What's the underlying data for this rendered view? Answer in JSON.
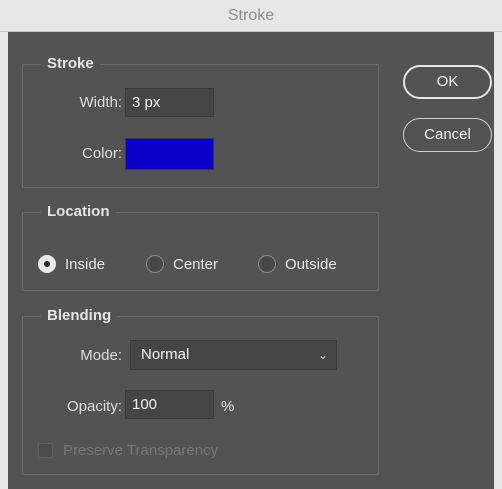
{
  "window": {
    "title": "Stroke"
  },
  "buttons": {
    "ok": "OK",
    "cancel": "Cancel"
  },
  "stroke": {
    "title": "Stroke",
    "width_label": "Width:",
    "width_value": "3 px",
    "color_label": "Color:",
    "color_value": "#0a00c8"
  },
  "location": {
    "title": "Location",
    "selected": "Inside",
    "options": [
      "Inside",
      "Center",
      "Outside"
    ]
  },
  "blending": {
    "title": "Blending",
    "mode_label": "Mode:",
    "mode_value": "Normal",
    "opacity_label": "Opacity:",
    "opacity_value": "100",
    "opacity_unit": "%",
    "preserve_label": "Preserve Transparency",
    "preserve_checked": false,
    "preserve_enabled": false
  }
}
